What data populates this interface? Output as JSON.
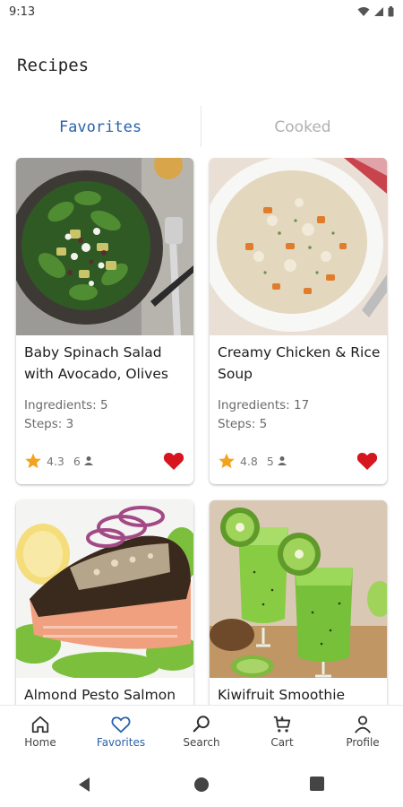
{
  "status": {
    "time": "9:13"
  },
  "header": {
    "title": "Recipes"
  },
  "tabs": [
    {
      "label": "Favorites",
      "active": true
    },
    {
      "label": "Cooked",
      "active": false
    }
  ],
  "recipes": [
    {
      "title": "Baby Spinach Salad with Avocado, Olives",
      "ingredients": "Ingredients: 5",
      "steps": "Steps: 3",
      "rating": "4.3",
      "people": "6",
      "favorite": true
    },
    {
      "title": "Creamy Chicken & Rice Soup",
      "ingredients": "Ingredients: 17",
      "steps": "Steps: 5",
      "rating": "4.8",
      "people": "5",
      "favorite": true
    },
    {
      "title": "Almond Pesto Salmon",
      "ingredients": "",
      "steps": "",
      "rating": "",
      "people": "",
      "favorite": true
    },
    {
      "title": "Kiwifruit Smoothie",
      "ingredients": "",
      "steps": "",
      "rating": "",
      "people": "",
      "favorite": true
    }
  ],
  "bottom_nav": [
    {
      "label": "Home",
      "icon": "home-icon"
    },
    {
      "label": "Favorites",
      "icon": "heart-icon",
      "active": true
    },
    {
      "label": "Search",
      "icon": "search-icon"
    },
    {
      "label": "Cart",
      "icon": "cart-icon"
    },
    {
      "label": "Profile",
      "icon": "person-icon"
    }
  ],
  "colors": {
    "accent": "#2962a8",
    "heart": "#d6151e",
    "star": "#f2a31b"
  }
}
